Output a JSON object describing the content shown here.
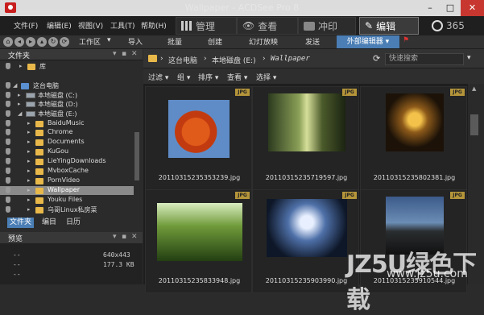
{
  "window": {
    "title": "Wallpaper - ACDSee Pro 8"
  },
  "menu": [
    "文件(F)",
    "编辑(E)",
    "视图(V)",
    "工具(T)",
    "帮助(H)"
  ],
  "modes": {
    "manage": "管理",
    "view": "查看",
    "print": "冲印",
    "edit": "编辑",
    "online": "365"
  },
  "toolbar": {
    "workspace": "工作区",
    "import": "导入",
    "batch": "批量",
    "create": "创建",
    "slideshow": "幻灯放映",
    "send": "发送",
    "external_editor": "外部编辑器"
  },
  "left_panel": {
    "title": "文件夹",
    "tree": [
      {
        "label": "库",
        "type": "folder"
      },
      {
        "label": "这台电脑",
        "type": "pc"
      },
      {
        "label": "本地磁盘 (C:)",
        "type": "drive"
      },
      {
        "label": "本地磁盘 (D:)",
        "type": "drive"
      },
      {
        "label": "本地磁盘 (E:)",
        "type": "drive"
      },
      {
        "label": "BaiduMusic",
        "type": "folder"
      },
      {
        "label": "Chrome",
        "type": "folder"
      },
      {
        "label": "Documents",
        "type": "folder"
      },
      {
        "label": "KuGou",
        "type": "folder"
      },
      {
        "label": "LieYingDownloads",
        "type": "folder"
      },
      {
        "label": "MvboxCache",
        "type": "folder"
      },
      {
        "label": "PornVideo",
        "type": "folder"
      },
      {
        "label": "Wallpaper",
        "type": "folder",
        "selected": true
      },
      {
        "label": "Youku Files",
        "type": "folder"
      },
      {
        "label": "乌哥Linux私房菜",
        "type": "folder"
      }
    ],
    "tabs": [
      "文件夹",
      "编目",
      "日历"
    ],
    "preview": {
      "title": "预览",
      "dims": "640x443",
      "size": "177.3 KB",
      "dash1": "--",
      "dash2": "--",
      "dash3": "--"
    }
  },
  "path": {
    "root": "这台电脑",
    "drive": "本地磁盘 (E:)",
    "folder": "Wallpaper",
    "search_placeholder": "快速搜索"
  },
  "filterbar": [
    "过滤",
    "组",
    "排序",
    "查看",
    "选择"
  ],
  "files": [
    {
      "name": "20110315235353239.jpg",
      "badge": "JPG"
    },
    {
      "name": "20110315235719597.jpg",
      "badge": "JPG"
    },
    {
      "name": "20110315235802381.jpg",
      "badge": "JPG"
    },
    {
      "name": "20110315235833948.jpg",
      "badge": "JPG"
    },
    {
      "name": "20110315235903990.jpg",
      "badge": "JPG"
    },
    {
      "name": "20110315235910544.jpg",
      "badge": "JPG"
    }
  ],
  "watermark": {
    "main": "JZ5U绿色下载",
    "url": "www.jz5u.com"
  }
}
